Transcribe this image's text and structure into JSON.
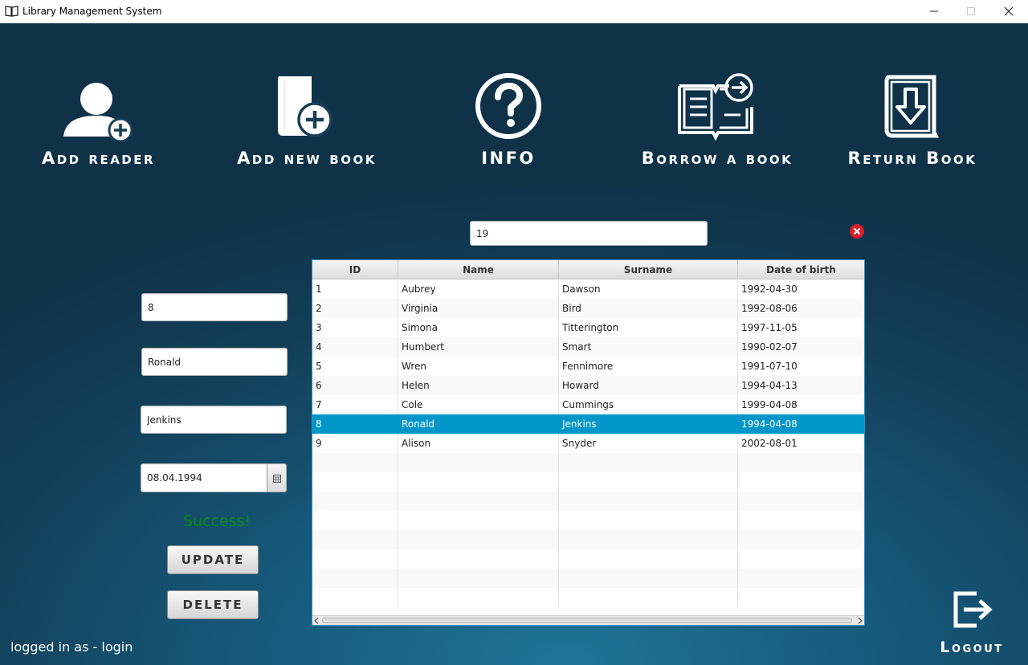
{
  "window": {
    "title": "Library Management System"
  },
  "nav": {
    "add_reader": "Add reader",
    "add_book": "Add new book",
    "info": "INFO",
    "borrow": "Borrow a book",
    "return": "Return Book",
    "logout": "Logout"
  },
  "search": {
    "value": "19"
  },
  "form": {
    "id": "8",
    "name": "Ronald",
    "surname": "Jenkins",
    "dob": "08.04.1994",
    "status": "Success!",
    "update_label": "UPDATE",
    "delete_label": "DELETE"
  },
  "table": {
    "columns": [
      "ID",
      "Name",
      "Surname",
      "Date of birth"
    ],
    "rows": [
      {
        "id": "1",
        "name": "Aubrey",
        "surname": "Dawson",
        "dob": "1992-04-30"
      },
      {
        "id": "2",
        "name": "Virginia",
        "surname": "Bird",
        "dob": "1992-08-06"
      },
      {
        "id": "3",
        "name": "Simona",
        "surname": "Titterington",
        "dob": "1997-11-05"
      },
      {
        "id": "4",
        "name": "Humbert",
        "surname": "Smart",
        "dob": "1990-02-07"
      },
      {
        "id": "5",
        "name": "Wren",
        "surname": "Fennimore",
        "dob": "1991-07-10"
      },
      {
        "id": "6",
        "name": "Helen",
        "surname": "Howard",
        "dob": "1994-04-13"
      },
      {
        "id": "7",
        "name": "Cole",
        "surname": "Cummings",
        "dob": "1999-04-08"
      },
      {
        "id": "8",
        "name": "Ronald",
        "surname": "Jenkins",
        "dob": "1994-04-08"
      },
      {
        "id": "9",
        "name": "Alison",
        "surname": "Snyder",
        "dob": "2002-08-01"
      }
    ],
    "selected_id": "8"
  },
  "footer": {
    "logged_in": "logged in as - login"
  },
  "colors": {
    "selection": "#0096c9",
    "status": "#0a8a14",
    "clear": "#d91e2a"
  }
}
